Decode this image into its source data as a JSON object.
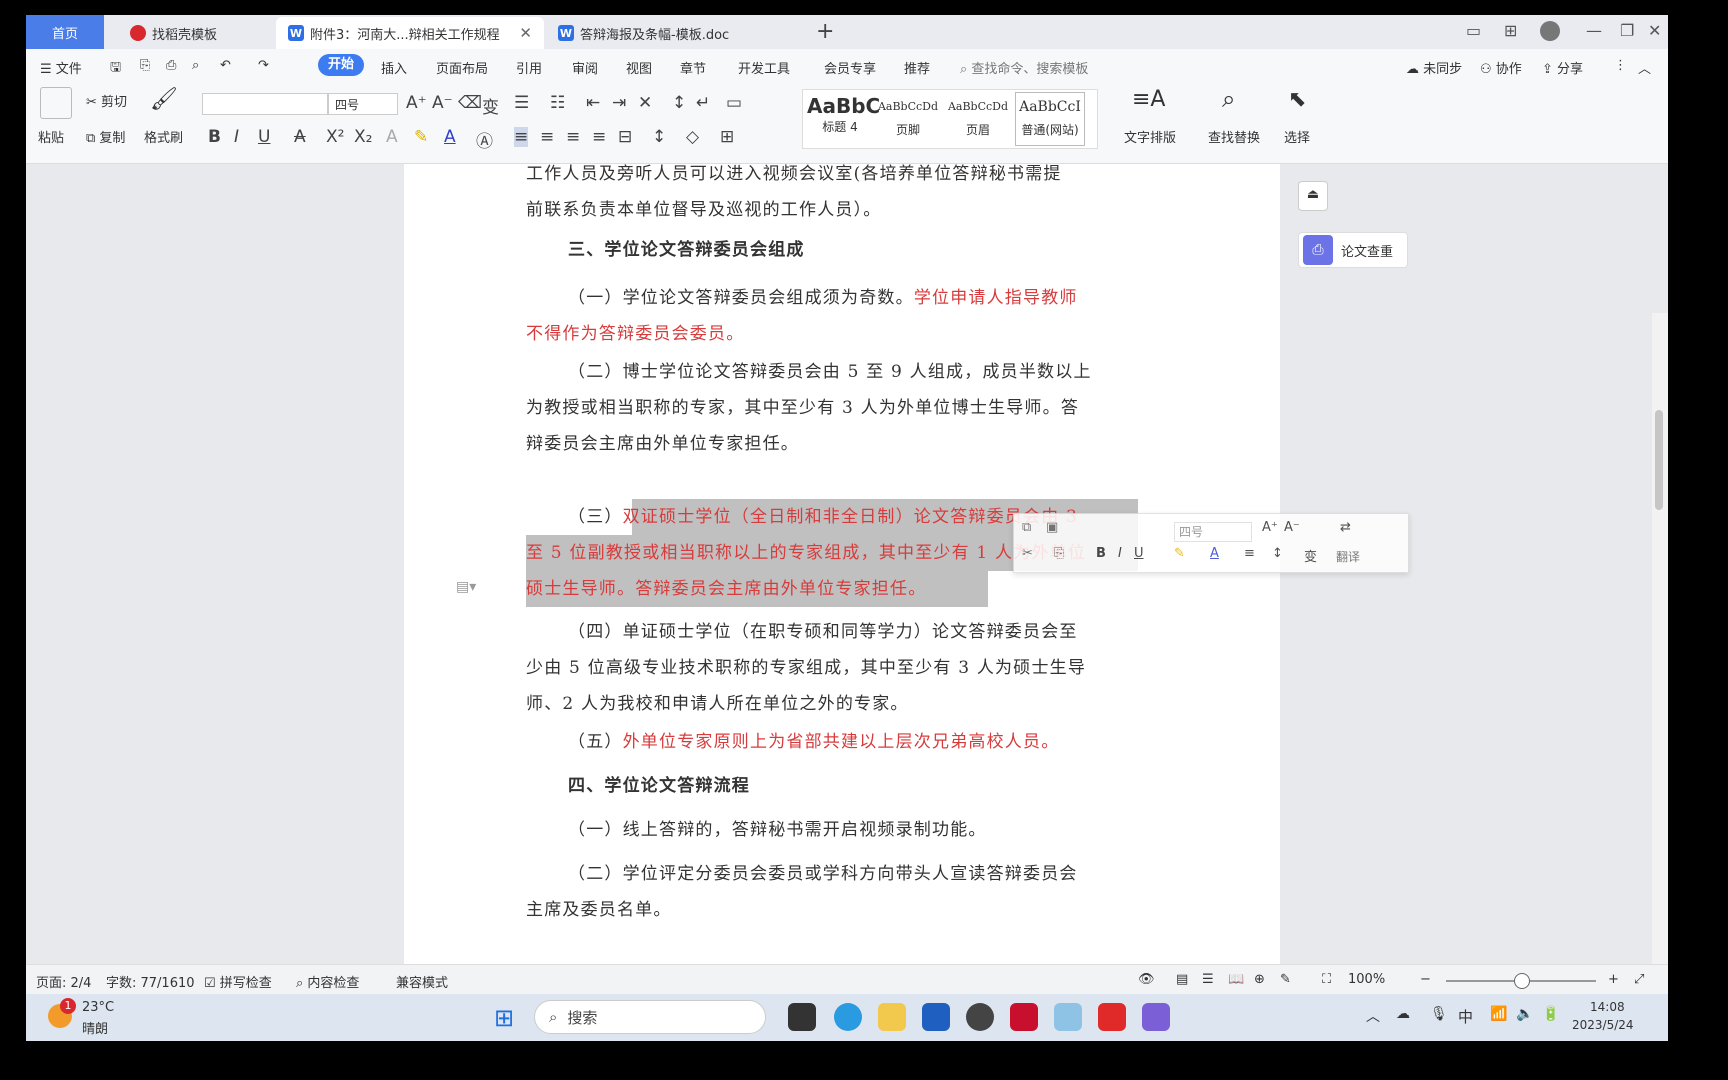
{
  "tabs": {
    "home": "首页",
    "t1": "找稻壳模板",
    "t2": "附件3：河南大...辩相关工作规程",
    "t3": "答辩海报及条幅-模板.doc"
  },
  "menu": {
    "file": "文件",
    "items": [
      "开始",
      "插入",
      "页面布局",
      "引用",
      "审阅",
      "视图",
      "章节",
      "开发工具",
      "会员专享",
      "推荐"
    ],
    "search": "查找命令、搜索模板",
    "sync": "未同步",
    "collab": "协作",
    "share": "分享"
  },
  "ribbon": {
    "paste": "粘贴",
    "cut": "剪切",
    "copy": "复制",
    "format_painter": "格式刷",
    "font_name": "",
    "font_size": "四号",
    "styles": [
      {
        "preview": "AaBbC",
        "name": "标题 4"
      },
      {
        "preview": "AaBbCcDd",
        "name": "页脚"
      },
      {
        "preview": "AaBbCcDd",
        "name": "页眉"
      },
      {
        "preview": "AaBbCcI",
        "name": "普通(网站)"
      }
    ],
    "text_layout": "文字排版",
    "find_replace": "查找替换",
    "select": "选择"
  },
  "document": {
    "p0a": "工作人员及旁听人员可以进入视频会议室(各培养单位答辩秘书需提",
    "p0b": "前联系负责本单位督导及巡视的工作人员）。",
    "h3": "三、学位论文答辩委员会组成",
    "p1_black": "（一）学位论文答辩委员会组成须为奇数。",
    "p1_red1": "学位申请人指导教师",
    "p1_red2": "不得作为答辩委员会委员。",
    "p2a": "（二）博士学位论文答辩委员会由 5 至 9 人组成，成员半数以上",
    "p2b": "为教授或相当职称的专家，其中至少有 3 人为外单位博士生导师。答",
    "p2c": "辩委员会主席由外单位专家担任。",
    "p3_prefix": "（三）",
    "p3a": "双证硕士学位（全日制和非全日制）论文答辩委员会由 3",
    "p3b": "至 5 位副教授或相当职称以上的专家组成，其中至少有 1 人为外单位",
    "p3c": "硕士生导师。答辩委员会主席由外单位专家担任。",
    "p4a": "（四）单证硕士学位（在职专硕和同等学力）论文答辩委员会至",
    "p4b": "少由 5 位高级专业技术职称的专家组成，其中至少有 3 人为硕士生导",
    "p4c": "师、2 人为我校和申请人所在单位之外的专家。",
    "p5_black": "（五）",
    "p5_red": "外单位专家原则上为省部共建以上层次兄弟高校人员。",
    "h4": "四、学位论文答辩流程",
    "p6": "（一）线上答辩的，答辩秘书需开启视频录制功能。",
    "p7a": "（二）学位评定分委员会委员或学科方向带头人宣读答辩委员会",
    "p7b": "主席及委员名单。"
  },
  "floatbar": {
    "font_size": "四号",
    "translate": "翻译"
  },
  "side": {
    "check": "论文查重"
  },
  "status": {
    "page": "页面: 2/4",
    "words": "字数: 77/1610",
    "spell": "拼写检查",
    "content": "内容检查",
    "compat": "兼容模式",
    "zoom": "100%"
  },
  "taskbar": {
    "weather_temp": "23°C",
    "weather_desc": "晴朗",
    "badge": "1",
    "search": "搜索",
    "ime": "中",
    "time": "14:08",
    "date": "2023/5/24"
  },
  "colors": {
    "accent": "#3d7cf0",
    "red_text": "#d83b3b",
    "selection": "#c0c0c0"
  }
}
